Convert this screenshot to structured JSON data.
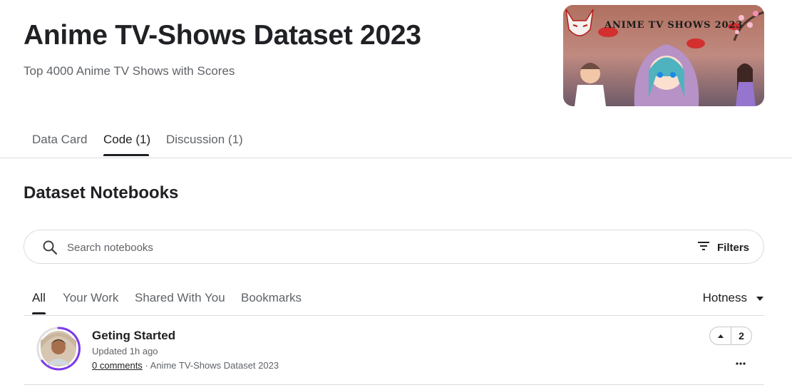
{
  "header": {
    "title": "Anime TV-Shows Dataset 2023",
    "subtitle": "Top 4000 Anime TV Shows with Scores",
    "banner_text": "ANIME TV SHOWS 2023"
  },
  "tabs": [
    {
      "label": "Data Card"
    },
    {
      "label": "Code (1)",
      "active": true
    },
    {
      "label": "Discussion (1)"
    }
  ],
  "section": {
    "title": "Dataset Notebooks"
  },
  "search": {
    "placeholder": "Search notebooks",
    "value": "",
    "filters_label": "Filters"
  },
  "subtabs": [
    {
      "label": "All",
      "active": true
    },
    {
      "label": "Your Work"
    },
    {
      "label": "Shared With You"
    },
    {
      "label": "Bookmarks"
    }
  ],
  "sort": {
    "label": "Hotness"
  },
  "notebooks": [
    {
      "title": "Geting Started",
      "updated": "Updated 1h ago",
      "comments": "0 comments",
      "separator": " · ",
      "dataset": "Anime TV-Shows Dataset 2023",
      "votes": "2"
    }
  ],
  "colors": {
    "accent_ring": "#7c3aed",
    "text": "#202124",
    "muted": "#5f6368",
    "border": "#dadce0"
  },
  "icons": [
    "search-icon",
    "filter-icon",
    "caret-down-icon",
    "upvote-icon",
    "more-icon"
  ]
}
